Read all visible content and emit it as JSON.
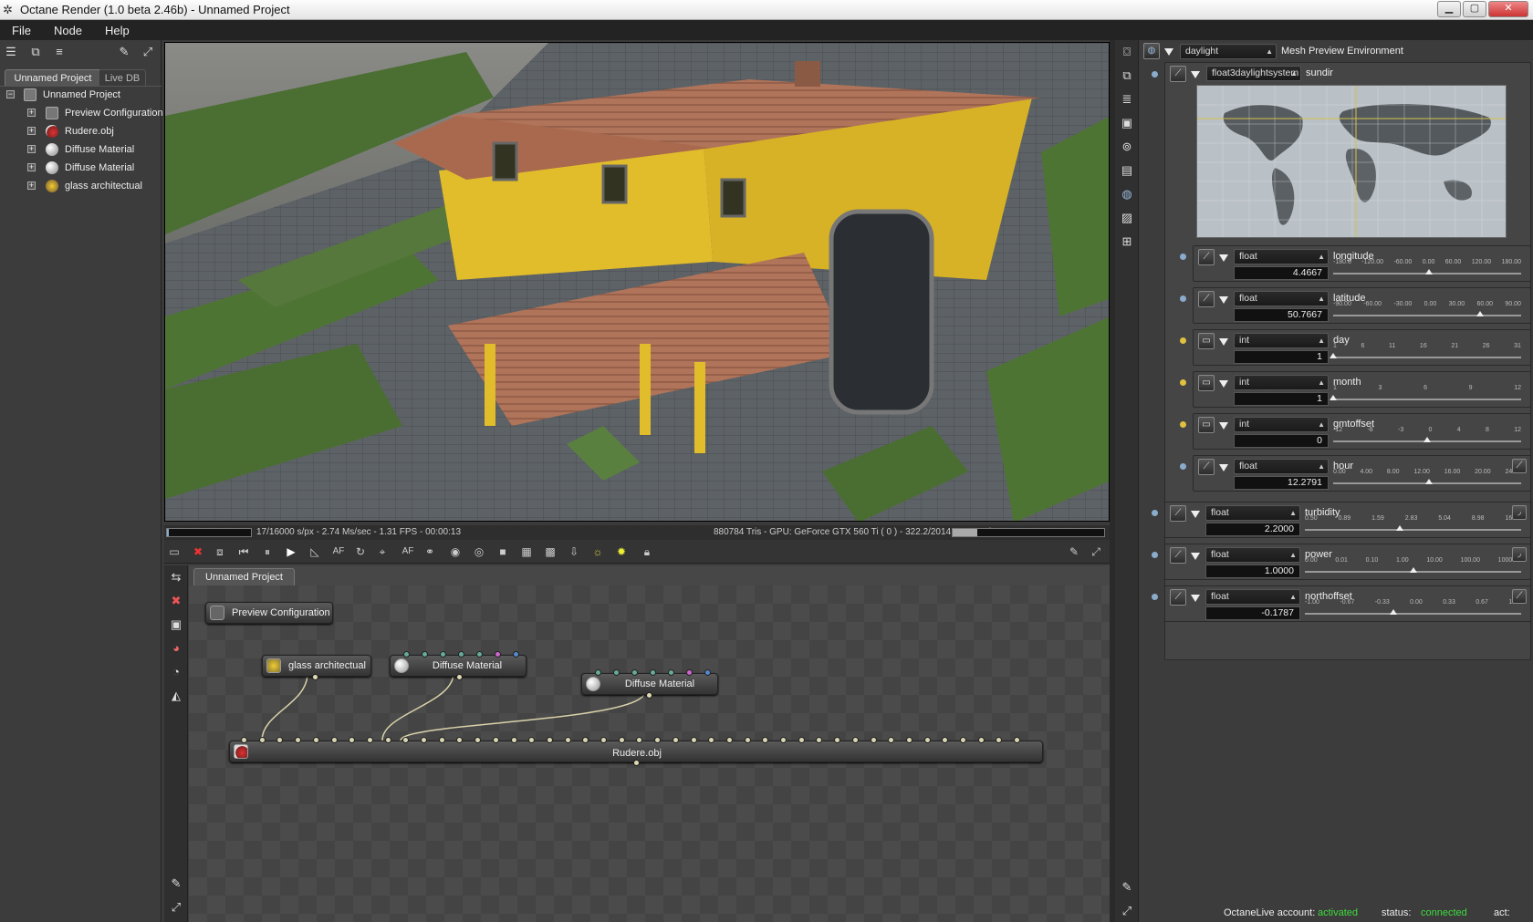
{
  "window": {
    "title": "Octane Render (1.0 beta 2.46b) - Unnamed Project"
  },
  "menu": [
    "File",
    "Node",
    "Help"
  ],
  "left_panel": {
    "tabs": [
      "Unnamed Project",
      "Live DB"
    ],
    "tree": [
      {
        "label": "Unnamed Project",
        "icon": "project-icon",
        "toggle": "−"
      },
      {
        "label": "Preview Configuration",
        "icon": "preview-config-icon",
        "toggle": "+"
      },
      {
        "label": "Rudere.obj",
        "icon": "mesh-icon",
        "toggle": "+"
      },
      {
        "label": "Diffuse Material",
        "icon": "material-sphere-icon",
        "toggle": "+"
      },
      {
        "label": "Diffuse Material",
        "icon": "material-sphere-icon",
        "toggle": "+"
      },
      {
        "label": "glass architectual",
        "icon": "glass-material-icon",
        "toggle": "+"
      }
    ]
  },
  "viewport": {
    "status_left": "17/16000 s/px - 2.74 Ms/sec - 1.31 FPS - 00:00:13",
    "status_right": "880784 Tris - GPU: GeForce GTX 560 Ti ( 0 ) - 322.2/2014 MB Used",
    "progress": 0.0011
  },
  "node_editor": {
    "tab": "Unnamed Project",
    "nodes": {
      "preview": "Preview Configuration",
      "glass": "glass architectual",
      "diffuse1": "Diffuse Material",
      "diffuse2": "Diffuse Material",
      "mesh": "Rudere.obj"
    }
  },
  "right_panel": {
    "env_select": "daylight",
    "env_label": "Mesh Preview Environment",
    "sundir_type": "float3daylightsystem",
    "sundir_label": "sundir",
    "params": [
      {
        "type": "float",
        "name": "longitude",
        "value": "4.4667",
        "ticks": [
          "-180.0",
          "-120.00",
          "-60.00",
          "0.00",
          "60.00",
          "120.00",
          "180.00"
        ],
        "pos": 0.512
      },
      {
        "type": "float",
        "name": "latitude",
        "value": "50.7667",
        "ticks": [
          "-90.00",
          "-60.00",
          "-30.00",
          "0.00",
          "30.00",
          "60.00",
          "90.00"
        ],
        "pos": 0.782
      },
      {
        "type": "int",
        "name": "day",
        "value": "1",
        "ticks": [
          "1",
          "6",
          "11",
          "16",
          "21",
          "26",
          "31"
        ],
        "pos": 0.0
      },
      {
        "type": "int",
        "name": "month",
        "value": "1",
        "ticks": [
          "1",
          "3",
          "6",
          "9",
          "12"
        ],
        "pos": 0.0
      },
      {
        "type": "int",
        "name": "gmtoffset",
        "value": "0",
        "ticks": [
          "-12",
          "-8",
          "-3",
          "0",
          "4",
          "8",
          "12"
        ],
        "pos": 0.5
      },
      {
        "type": "float",
        "name": "hour",
        "value": "12.2791",
        "ticks": [
          "0.00",
          "4.00",
          "8.00",
          "12.00",
          "16.00",
          "20.00",
          "24.00"
        ],
        "pos": 0.512
      },
      {
        "type": "float",
        "name": "turbidity",
        "value": "2.2000",
        "ticks": [
          "0.50",
          "0.89",
          "1.59",
          "2.83",
          "5.04",
          "8.98",
          "16.00"
        ],
        "pos": 0.44
      },
      {
        "type": "float",
        "name": "power",
        "value": "1.0000",
        "ticks": [
          "0.00",
          "0.01",
          "0.10",
          "1.00",
          "10.00",
          "100.00",
          "1000.00"
        ],
        "pos": 0.5
      },
      {
        "type": "float",
        "name": "northoffset",
        "value": "-0.1787",
        "ticks": [
          "-1.00",
          "-0.67",
          "-0.33",
          "0.00",
          "0.33",
          "0.67",
          "1.00"
        ],
        "pos": 0.41
      }
    ]
  },
  "bottom_bar": {
    "account_label": "OctaneLive account:",
    "account_value": "activated",
    "status_label": "status:",
    "status_value": "connected",
    "act_label": "act:"
  },
  "colors": {
    "accent_green": "#3ddc3d",
    "pin_yellow": "#e0c040",
    "pin_blue": "#8aaccc"
  }
}
